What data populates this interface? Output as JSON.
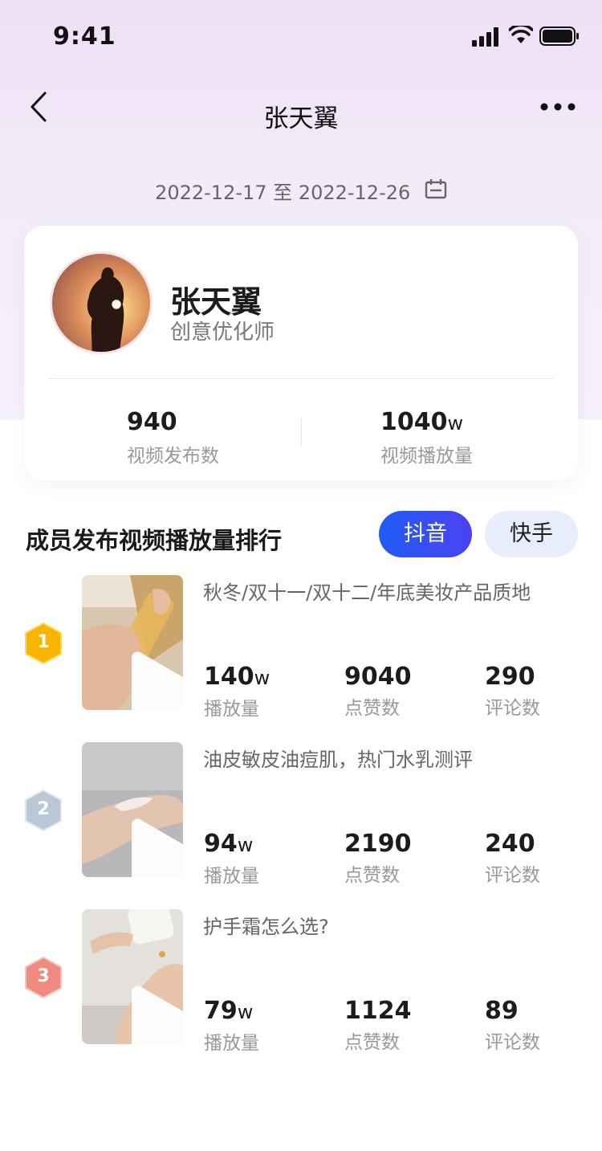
{
  "status_bar": {
    "time": "9:41"
  },
  "nav": {
    "title": "张天翼"
  },
  "date_range": "2022-12-17 至 2022-12-26",
  "profile": {
    "name": "张天翼",
    "role": "创意优化师",
    "stats": [
      {
        "value": "940",
        "unit": "",
        "label": "视频发布数"
      },
      {
        "value": "1040",
        "unit": "w",
        "label": "视频播放量"
      }
    ]
  },
  "section": {
    "title": "成员发布视频播放量排行",
    "tabs": [
      {
        "label": "抖音",
        "active": true
      },
      {
        "label": "快手",
        "active": false
      }
    ]
  },
  "ranking": [
    {
      "rank": "1",
      "title": "秋冬/双十一/双十二/年底美妆产品质地",
      "plays": "140",
      "plays_unit": "w",
      "plays_label": "播放量",
      "likes": "9040",
      "likes_label": "点赞数",
      "comments": "290",
      "comments_label": "评论数"
    },
    {
      "rank": "2",
      "title": "油皮敏皮油痘肌，热门水乳测评",
      "plays": "94",
      "plays_unit": "w",
      "plays_label": "播放量",
      "likes": "2190",
      "likes_label": "点赞数",
      "comments": "240",
      "comments_label": "评论数"
    },
    {
      "rank": "3",
      "title": "护手霜怎么选?",
      "plays": "79",
      "plays_unit": "w",
      "plays_label": "播放量",
      "likes": "1124",
      "likes_label": "点赞数",
      "comments": "89",
      "comments_label": "评论数"
    }
  ],
  "colors": {
    "accent": "#1f5cf5",
    "badge_gold": "#f7b500",
    "badge_silver": "#b9c8d6",
    "badge_bronze": "#ef8a7f"
  },
  "icons": [
    "signal-icon",
    "wifi-icon",
    "battery-icon",
    "back-icon",
    "more-icon",
    "calendar-icon",
    "play-icon"
  ]
}
